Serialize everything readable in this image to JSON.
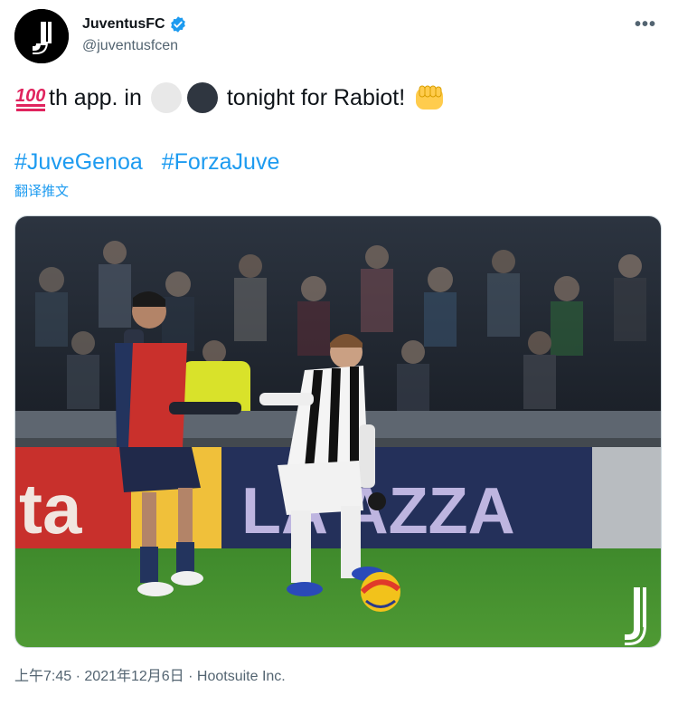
{
  "account": {
    "display_name": "JuventusFC",
    "handle": "@juventusfcen",
    "avatar_icon": "juventus-j-logo",
    "verified_icon": "verified-badge-icon"
  },
  "tweet": {
    "text_prefix": "th app. in",
    "text_suffix": "tonight for Rabiot!",
    "emoji_100": "hundred-points-emoji",
    "emoji_white_circle": "white-circle-emoji",
    "emoji_black_circle": "black-circle-emoji",
    "emoji_fist": "oncoming-fist-emoji",
    "hashtags": [
      "#JuveGenoa",
      "#ForzaJuve"
    ],
    "translate_label": "翻译推文"
  },
  "photo": {
    "description_icon": "match-photo",
    "watermark": "juventus-j-logo"
  },
  "meta": {
    "time": "上午7:45",
    "date": "2021年12月6日",
    "source": "Hootsuite Inc."
  },
  "colors": {
    "link": "#1d9bf0",
    "secondary_text": "#536471",
    "verified": "#1d9bf0"
  }
}
